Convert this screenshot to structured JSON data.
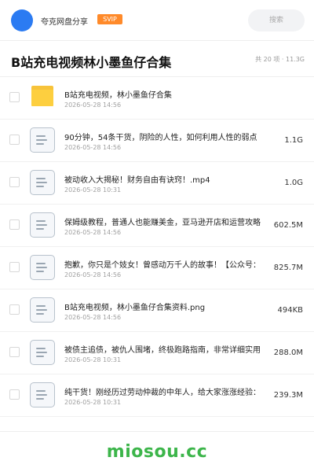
{
  "header": {
    "username": "夸克网盘分享",
    "badge": "SVIP",
    "search_placeholder": "搜索",
    "colors": {
      "avatar": "#2b7bf2",
      "badge": "#ff8a2a"
    }
  },
  "folder": {
    "title": "B站充电视频林小墨鱼仔合集",
    "meta": "共 20 项 · 11.3G"
  },
  "files": [
    {
      "name": "B站充电视频，林小墨鱼仔合集",
      "date": "2026-05-28 14:56",
      "size": "",
      "icon": "folder-icon"
    },
    {
      "name": "90分钟，54条干货，阴险的人性，如何利用人性的弱点",
      "date": "2026-05-28 14:56",
      "size": "1.1G",
      "icon": "document-icon"
    },
    {
      "name": "被动收入大揭秘！财务自由有诀窍！.mp4",
      "date": "2026-05-28 10:31",
      "size": "1.0G",
      "icon": "document-icon"
    },
    {
      "name": "保姆级教程，普通人也能赚美金，亚马逊开店和运营攻略",
      "date": "2026-05-28 14:56",
      "size": "602.5M",
      "icon": "document-icon"
    },
    {
      "name": "抱歉，你只是个妓女！曾感动万千人的故事！【公众号：",
      "date": "2026-05-28 14:56",
      "size": "825.7M",
      "icon": "document-icon"
    },
    {
      "name": "B站充电视频，林小墨鱼仔合集资料.png",
      "date": "2026-05-28 14:56",
      "size": "494KB",
      "icon": "document-icon"
    },
    {
      "name": "被债主追债，被仇人围堵，终极跑路指南，非常详细实用",
      "date": "2026-05-28 10:31",
      "size": "288.0M",
      "icon": "document-icon"
    },
    {
      "name": "纯干货！刚经历过劳动仲裁的中年人，给大家涨涨经验：",
      "date": "2026-05-28 10:31",
      "size": "239.3M",
      "icon": "document-icon"
    }
  ],
  "watermark": {
    "text": "miosou.cc",
    "color": "#3cb54a"
  }
}
